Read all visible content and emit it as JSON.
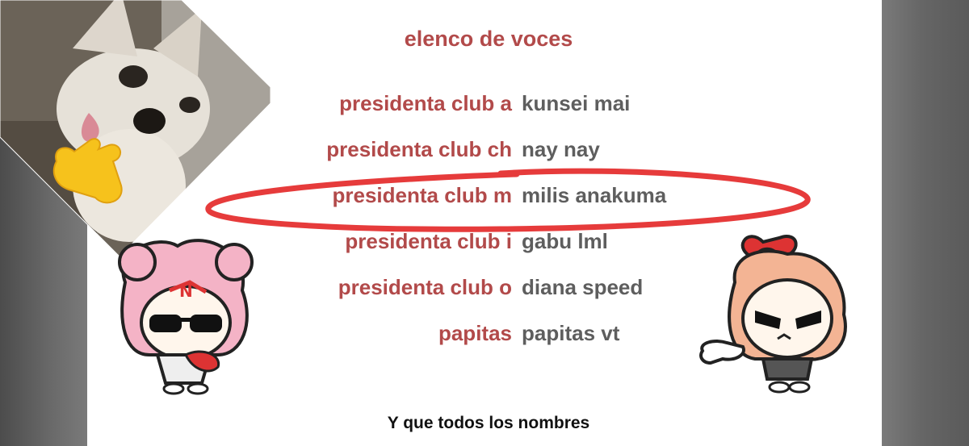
{
  "title": "elenco de voces",
  "cast": [
    {
      "role": "presidenta club a",
      "actor": "kunsei mai"
    },
    {
      "role": "presidenta club ch",
      "actor": "nay nay"
    },
    {
      "role": "presidenta club m",
      "actor": "milis anakuma",
      "highlighted": true
    },
    {
      "role": "presidenta club i",
      "actor": "gabu lml"
    },
    {
      "role": "presidenta club o",
      "actor": "diana speed"
    },
    {
      "role": "papitas",
      "actor": "papitas vt"
    }
  ],
  "footer": "Y que todos los nombres",
  "colors": {
    "role": "#b24a4a",
    "actor": "#5e5e5e",
    "highlight": "#e63b3b"
  },
  "stickers": [
    "chihuahua-meme",
    "shaka-emoji",
    "pink-chibi-character",
    "red-bow-chibi-character"
  ]
}
